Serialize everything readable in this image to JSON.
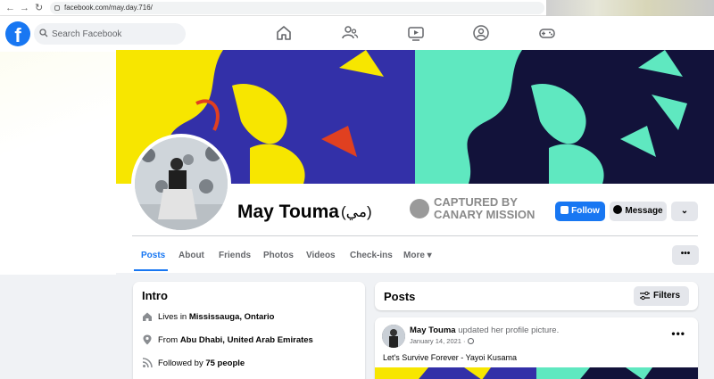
{
  "browser": {
    "back": "←",
    "forward": "→",
    "reload": "↻",
    "url": "facebook.com/may.day.716/"
  },
  "fb": {
    "logo": "f",
    "search_placeholder": "Search Facebook",
    "nav_icons": [
      "home-icon",
      "friends-icon",
      "watch-icon",
      "groups-icon",
      "gaming-icon"
    ]
  },
  "profile": {
    "name": "May Touma",
    "alt_name": "(مي)",
    "captured_line1": "CAPTURED BY",
    "captured_line2": "CANARY MISSION",
    "follow_label": "Follow",
    "message_label": "Message",
    "more_label": "⌄"
  },
  "tabs": [
    {
      "label": "Posts",
      "active": true
    },
    {
      "label": "About"
    },
    {
      "label": "Friends"
    },
    {
      "label": "Photos"
    },
    {
      "label": "Videos"
    },
    {
      "label": "Check-ins"
    },
    {
      "label": "More ▾"
    }
  ],
  "tab_more_label": "•••",
  "intro": {
    "title": "Intro",
    "lives_prefix": "Lives in ",
    "lives_value": "Mississauga, Ontario",
    "from_prefix": "From ",
    "from_value": "Abu Dhabi, United Arab Emirates",
    "followed_prefix": "Followed by ",
    "followed_value": "75 people"
  },
  "posts": {
    "title": "Posts",
    "filters_label": "Filters"
  },
  "post": {
    "author": "May Touma",
    "action": " updated her profile picture.",
    "date": "January 14, 2021 · ",
    "dots": "•••",
    "text": "Let's Survive Forever - Yayoi Kusama"
  },
  "colors": {
    "brand": "#1877f2",
    "cover_yellow": "#f7e600",
    "cover_blue": "#3330a8",
    "cover_teal": "#5fe8c0",
    "cover_dark": "#12123a"
  }
}
